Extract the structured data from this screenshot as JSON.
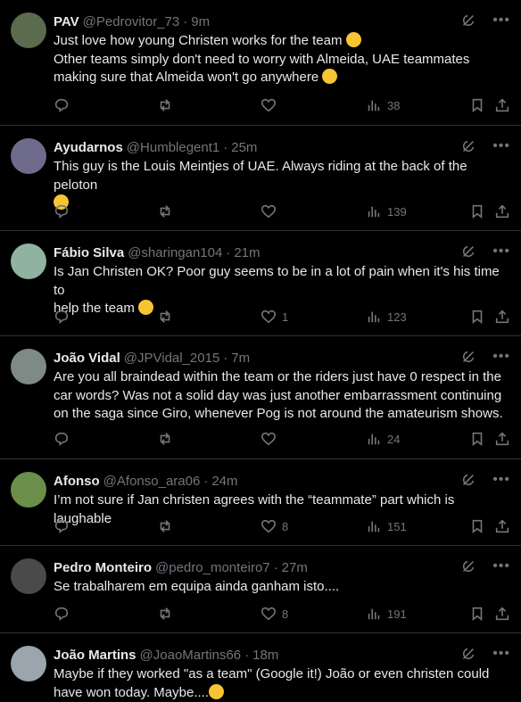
{
  "tweets": [
    {
      "name": "PAV",
      "handle": "@Pedrovitor_73",
      "time": "9m",
      "lines": [
        "Just love how young Christen works for the team",
        "Other teams simply don't need to worry with Almeida, UAE teammates",
        "making sure that Almeida won't go anywhere"
      ],
      "emojis": [
        "heart-eyes",
        "none",
        "tears-of-joy"
      ],
      "likes": "",
      "views": "38",
      "avatar_color": "#5a6b4e"
    },
    {
      "name": "Ayudarnos",
      "handle": "@Humblegent1",
      "time": "25m",
      "lines": [
        "This guy is the Louis Meintjes of UAE. Always riding at the back of the peloton",
        ""
      ],
      "emojis": [
        "none",
        "crying"
      ],
      "likes": "",
      "views": "139",
      "avatar_color": "#6f6b8c"
    },
    {
      "name": "Fábio Silva",
      "handle": "@sharingan104",
      "time": "21m",
      "lines": [
        "Is Jan Christen OK? Poor guy seems to be in a lot of pain when it's his time to",
        "help the team"
      ],
      "emojis": [
        "none",
        "crying"
      ],
      "likes": "1",
      "views": "123",
      "avatar_color": "#8fb3a0"
    },
    {
      "name": "João Vidal",
      "handle": "@JPVidal_2015",
      "time": "7m",
      "lines": [
        "Are you all braindead within the team or the riders just have 0 respect in the",
        "car words? Was not a solid day was just another embarrassment continuing",
        "on the saga since Giro, whenever Pog is not around the amateurism shows."
      ],
      "emojis": [
        "none",
        "none",
        "none"
      ],
      "likes": "",
      "views": "24",
      "avatar_color": "#7d8a86"
    },
    {
      "name": "Afonso",
      "handle": "@Afonso_ara06",
      "time": "24m",
      "lines": [
        "I’m not sure if Jan christen agrees with the “teammate” part which is laughable"
      ],
      "emojis": [
        "none"
      ],
      "likes": "8",
      "views": "151",
      "avatar_color": "#6b8f4a"
    },
    {
      "name": "Pedro Monteiro",
      "handle": "@pedro_monteiro7",
      "time": "27m",
      "lines": [
        "Se trabalharem em equipa ainda ganham isto...."
      ],
      "emojis": [
        "none"
      ],
      "likes": "8",
      "views": "191",
      "avatar_color": "#4a4a4a"
    },
    {
      "name": "João Martins",
      "handle": "@JoaoMartins66",
      "time": "18m",
      "lines": [
        "Maybe if they worked \"as a team\" (Google it!) João or even christen could",
        "have won today. Maybe...."
      ],
      "emojis": [
        "none",
        "thinking"
      ],
      "likes": "",
      "views": "",
      "avatar_color": "#9aa5ad"
    }
  ],
  "separator": "·",
  "colors": {
    "text": "#e7e9ea",
    "muted": "#71767b",
    "divider": "#2f3336",
    "background": "#000000"
  }
}
